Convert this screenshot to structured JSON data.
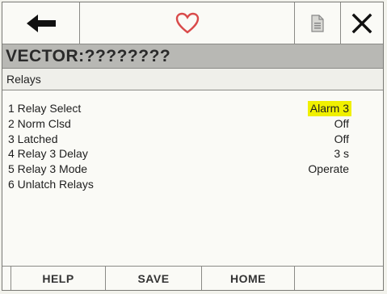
{
  "toolbar": {
    "back_icon": "back-arrow-icon",
    "favorite_icon": "heart-icon",
    "document_icon": "document-icon",
    "close_icon": "close-icon",
    "heart_color": "#d94a4a"
  },
  "device_title": "VECTOR:????????",
  "section_title": "Relays",
  "menu": {
    "items": [
      {
        "label": "1 Relay Select",
        "value": "Alarm 3",
        "highlighted": true
      },
      {
        "label": "2 Norm Clsd",
        "value": "Off"
      },
      {
        "label": "3 Latched",
        "value": "Off"
      },
      {
        "label": "4 Relay 3 Delay",
        "value": "3 s"
      },
      {
        "label": "5 Relay 3 Mode",
        "value": "Operate"
      },
      {
        "label": "6 Unlatch Relays",
        "value": ""
      }
    ]
  },
  "footer": {
    "help_label": "HELP",
    "save_label": "SAVE",
    "home_label": "HOME"
  },
  "colors": {
    "highlight": "#f0f000",
    "title_bar": "#b8b8b4"
  }
}
